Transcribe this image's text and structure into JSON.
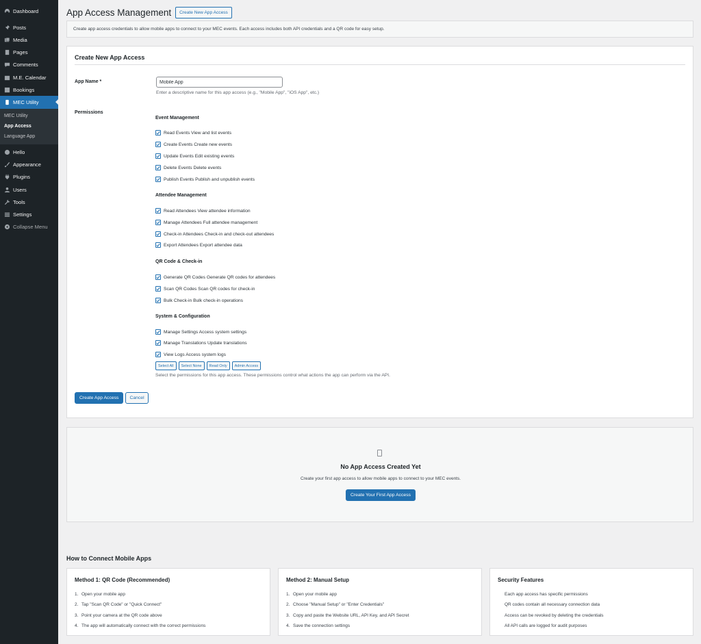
{
  "sidebar": {
    "items": [
      {
        "label": "Dashboard",
        "icon": "dashboard-icon"
      },
      {
        "label": "Posts",
        "icon": "pin-icon"
      },
      {
        "label": "Media",
        "icon": "media-icon"
      },
      {
        "label": "Pages",
        "icon": "pages-icon"
      },
      {
        "label": "Comments",
        "icon": "comment-icon"
      },
      {
        "label": "M.E. Calendar",
        "icon": "calendar-icon"
      },
      {
        "label": "Bookings",
        "icon": "bookings-icon"
      },
      {
        "label": "MEC Utility",
        "icon": "mobile-icon"
      }
    ],
    "submenu": [
      "MEC Utility",
      "App Access",
      "Language App"
    ],
    "items2": [
      {
        "label": "Hello",
        "icon": "plus-icon"
      },
      {
        "label": "Appearance",
        "icon": "brush-icon"
      },
      {
        "label": "Plugins",
        "icon": "plugin-icon"
      },
      {
        "label": "Users",
        "icon": "users-icon"
      },
      {
        "label": "Tools",
        "icon": "wrench-icon"
      },
      {
        "label": "Settings",
        "icon": "settings-icon"
      },
      {
        "label": "Collapse Menu",
        "icon": "collapse-icon"
      }
    ]
  },
  "header": {
    "title": "App Access Management",
    "create_button": "Create New App Access"
  },
  "notice": "Create app access credentials to allow mobile apps to connect to your MEC events. Each access includes both API credentials and a QR code for easy setup.",
  "form": {
    "card_title": "Create New App Access",
    "app_name_label": "App Name *",
    "app_name_value": "Mobile App",
    "app_name_desc": "Enter a descriptive name for this app access (e.g., \"Mobile App\", \"iOS App\", etc.)",
    "permissions_label": "Permissions",
    "groups": [
      {
        "title": "Event Management",
        "items": [
          "Read Events View and list events",
          "Create Events Create new events",
          "Update Events Edit existing events",
          "Delete Events Delete events",
          "Publish Events Publish and unpublish events"
        ]
      },
      {
        "title": "Attendee Management",
        "items": [
          "Read Attendees View attendee information",
          "Manage Attendees Full attendee management",
          "Check-in Attendees Check-in and check-out attendees",
          "Export Attendees Export attendee data"
        ]
      },
      {
        "title": "QR Code & Check-in",
        "items": [
          "Generate QR Codes Generate QR codes for attendees",
          "Scan QR Codes Scan QR codes for check-in",
          "Bulk Check-in Bulk check-in operations"
        ]
      },
      {
        "title": "System & Configuration",
        "items": [
          "Manage Settings Access system settings",
          "Manage Translations Update translations",
          "View Logs Access system logs"
        ]
      }
    ],
    "quick_buttons": [
      "Select All",
      "Select None",
      "Read Only",
      "Admin Access"
    ],
    "permissions_desc": "Select the permissions for this app access. These permissions control what actions the app can perform via the API.",
    "submit": "Create App Access",
    "cancel": "Cancel"
  },
  "empty": {
    "title": "No App Access Created Yet",
    "subtitle": "Create your first app access to allow mobile apps to connect to your MEC events.",
    "button": "Create Your First App Access"
  },
  "howto": {
    "title": "How to Connect Mobile Apps",
    "cards": [
      {
        "title": "Method 1: QR Code (Recommended)",
        "ordered": true,
        "items": [
          "Open your mobile app",
          "Tap \"Scan QR Code\" or \"Quick Connect\"",
          "Point your camera at the QR code above",
          "The app will automatically connect with the correct permissions"
        ]
      },
      {
        "title": "Method 2: Manual Setup",
        "ordered": true,
        "items": [
          "Open your mobile app",
          "Choose \"Manual Setup\" or \"Enter Credentials\"",
          "Copy and paste the Website URL, API Key, and API Secret",
          "Save the connection settings"
        ]
      },
      {
        "title": "Security Features",
        "ordered": false,
        "items": [
          "Each app access has specific permissions",
          "QR codes contain all necessary connection data",
          "Access can be revoked by deleting the credentials",
          "All API calls are logged for audit purposes"
        ]
      }
    ]
  },
  "colors": {
    "accent": "#2271b1",
    "sidebar_bg": "#1d2327",
    "page_bg": "#f0f0f1"
  }
}
